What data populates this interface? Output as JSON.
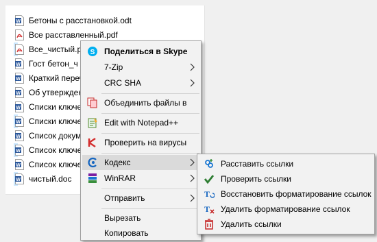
{
  "files": [
    {
      "name": "Бетоны с расстановкой.odt",
      "type": "odt",
      "selected": false
    },
    {
      "name": "Все расставленный.pdf",
      "type": "pdf",
      "selected": false
    },
    {
      "name": "Все_чистый.pdf",
      "type": "pdf",
      "selected": true
    },
    {
      "name": "Гост бетон_ч",
      "type": "doc",
      "selected": false
    },
    {
      "name": "Краткий переч",
      "type": "doc",
      "selected": false
    },
    {
      "name": "Об утвержден",
      "type": "doc",
      "selected": false
    },
    {
      "name": "Списки ключе",
      "type": "doc",
      "selected": false
    },
    {
      "name": "Списки ключе",
      "type": "doc",
      "selected": true
    },
    {
      "name": "Список докум",
      "type": "doc",
      "selected": false
    },
    {
      "name": "Список ключе",
      "type": "doc",
      "selected": true
    },
    {
      "name": "Список ключе",
      "type": "doc",
      "selected": false
    },
    {
      "name": "чистый.doc",
      "type": "doc",
      "selected": true
    }
  ],
  "context_menu": {
    "share_skype": "Поделиться в Skype",
    "zip7": "7-Zip",
    "crc_sha": "CRC SHA",
    "merge_files": "Объединить файлы в",
    "edit_notepad": "Edit with Notepad++",
    "check_virus": "Проверить на вирусы",
    "kodeks": "Кодекс",
    "winrar": "WinRAR",
    "send_to": "Отправить",
    "cut": "Вырезать",
    "copy": "Копировать"
  },
  "kodeks_submenu": {
    "place_links": "Расставить ссылки",
    "check_links": "Проверить ссылки",
    "restore_formatting": "Восстановить форматирование ссылок",
    "delete_formatting": "Удалить форматирование ссылок",
    "delete_links": "Удалить ссылки"
  },
  "colors": {
    "selection": "#cce8ff",
    "menu_bg": "#f2f2f2",
    "menu_highlight": "#dadada",
    "word_blue": "#2b579a",
    "pdf_red": "#d32f2f",
    "skype_blue": "#00aff0"
  }
}
